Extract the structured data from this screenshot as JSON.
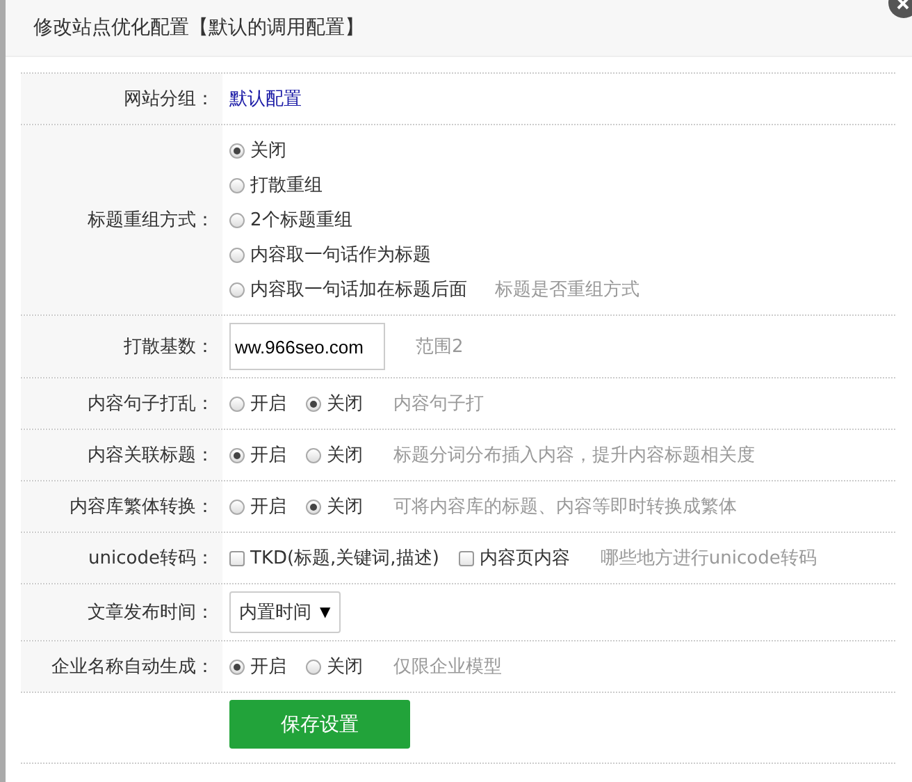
{
  "dialog": {
    "title": "修改站点优化配置【默认的调用配置】"
  },
  "rows": [
    {
      "kind": "link",
      "label": "网站分组：",
      "value": "默认配置"
    },
    {
      "kind": "radio-stack",
      "label": "标题重组方式：",
      "options": [
        {
          "label": "关闭",
          "selected": true
        },
        {
          "label": "打散重组",
          "selected": false
        },
        {
          "label": "2个标题重组",
          "selected": false
        },
        {
          "label": "内容取一句话作为标题",
          "selected": false
        },
        {
          "label": "内容取一句话加在标题后面",
          "selected": false
        }
      ],
      "hint": "标题是否重组方式"
    },
    {
      "kind": "input",
      "label": "打散基数：",
      "value": "ww.966seo.com",
      "hint": "范围2"
    },
    {
      "kind": "radio",
      "label": "内容句子打乱：",
      "options": [
        {
          "label": "开启",
          "selected": false
        },
        {
          "label": "关闭",
          "selected": true
        }
      ],
      "hint": "内容句子打"
    },
    {
      "kind": "radio",
      "label": "内容关联标题：",
      "options": [
        {
          "label": "开启",
          "selected": true
        },
        {
          "label": "关闭",
          "selected": false
        }
      ],
      "hint": "标题分词分布插入内容，提升内容标题相关度"
    },
    {
      "kind": "radio",
      "label": "内容库繁体转换：",
      "options": [
        {
          "label": "开启",
          "selected": false
        },
        {
          "label": "关闭",
          "selected": true
        }
      ],
      "hint": "可将内容库的标题、内容等即时转换成繁体"
    },
    {
      "kind": "checkbox",
      "label": "unicode转码：",
      "options": [
        {
          "label": "TKD(标题,关键词,描述)",
          "checked": false
        },
        {
          "label": "内容页内容",
          "checked": false
        }
      ],
      "hint": "哪些地方进行unicode转码"
    },
    {
      "kind": "select",
      "label": "文章发布时间：",
      "value": "内置时间",
      "arrow": "▼"
    },
    {
      "kind": "radio",
      "label": "企业名称自动生成：",
      "options": [
        {
          "label": "开启",
          "selected": true
        },
        {
          "label": "关闭",
          "selected": false
        }
      ],
      "hint": "仅限企业模型"
    }
  ],
  "save_button": "保存设置"
}
